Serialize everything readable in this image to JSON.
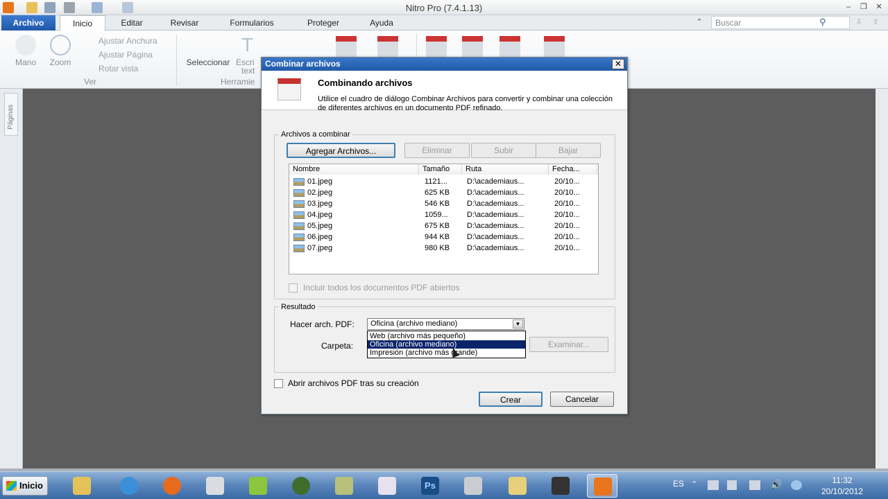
{
  "window": {
    "title": "Nitro Pro (7.4.1.13)"
  },
  "tabs": [
    {
      "label": "Archivo"
    },
    {
      "label": "Inicio"
    },
    {
      "label": "Editar"
    },
    {
      "label": "Revisar"
    },
    {
      "label": "Formularios"
    },
    {
      "label": "Proteger"
    },
    {
      "label": "Ayuda"
    }
  ],
  "search": {
    "placeholder": "Buscar"
  },
  "ribbon": {
    "hand": "Mano",
    "zoom": "Zoom",
    "fit_width": "Ajustar Anchura",
    "fit_page": "Ajustar Página",
    "rotate": "Rotar vista",
    "view_group": "Ver",
    "select": "Seleccionar",
    "write_text": "Escri",
    "write_text2": "text",
    "tools_group": "Herramie"
  },
  "sidebar": {
    "tab": "Páginas"
  },
  "dialog": {
    "title": "Combinar archivos",
    "close": "✕",
    "header_title": "Combinando archivos",
    "header_desc": "Utilice el cuadro de diálogo Combinar Archivos para convertir y combinar una colección de diferentes archivos en un documento PDF refinado.",
    "files_group": "Archivos a combinar",
    "add_files": "Agregar Archivos...",
    "remove": "Eliminar",
    "up": "Subir",
    "down": "Bajar",
    "columns": [
      "Nombre",
      "Tamaño",
      "Ruta",
      "Fecha..."
    ],
    "files": [
      {
        "name": "01.jpeg",
        "size": "1121...",
        "path": "D:\\academiaus...",
        "date": "20/10..."
      },
      {
        "name": "02.jpeg",
        "size": "625 KB",
        "path": "D:\\academiaus...",
        "date": "20/10..."
      },
      {
        "name": "03.jpeg",
        "size": "546 KB",
        "path": "D:\\academiaus...",
        "date": "20/10..."
      },
      {
        "name": "04.jpeg",
        "size": "1059...",
        "path": "D:\\academiaus...",
        "date": "20/10..."
      },
      {
        "name": "05.jpeg",
        "size": "675 KB",
        "path": "D:\\academiaus...",
        "date": "20/10..."
      },
      {
        "name": "06.jpeg",
        "size": "944 KB",
        "path": "D:\\academiaus...",
        "date": "20/10..."
      },
      {
        "name": "07.jpeg",
        "size": "980 KB",
        "path": "D:\\academiaus...",
        "date": "20/10..."
      }
    ],
    "include_open": "Incluir todos los documentos PDF abiertos",
    "result_group": "Resultado",
    "make_pdf_label": "Hacer arch. PDF:",
    "make_pdf_value": "Oficina (archivo mediano)",
    "options": [
      "Web (archivo más pequeño)",
      "Oficina (archivo mediano)",
      "Impresión (archivo más grande)"
    ],
    "folder_label": "Carpeta:",
    "browse": "Examinar...",
    "open_after": "Abrir archivos PDF tras su creación",
    "create": "Crear",
    "cancel": "Cancelar"
  },
  "taskbar": {
    "start": "Inicio",
    "lang": "ES",
    "time": "11:32",
    "date": "20/10/2012"
  },
  "colors": {
    "accent": "#1f57a8",
    "selection": "#0a246a"
  }
}
